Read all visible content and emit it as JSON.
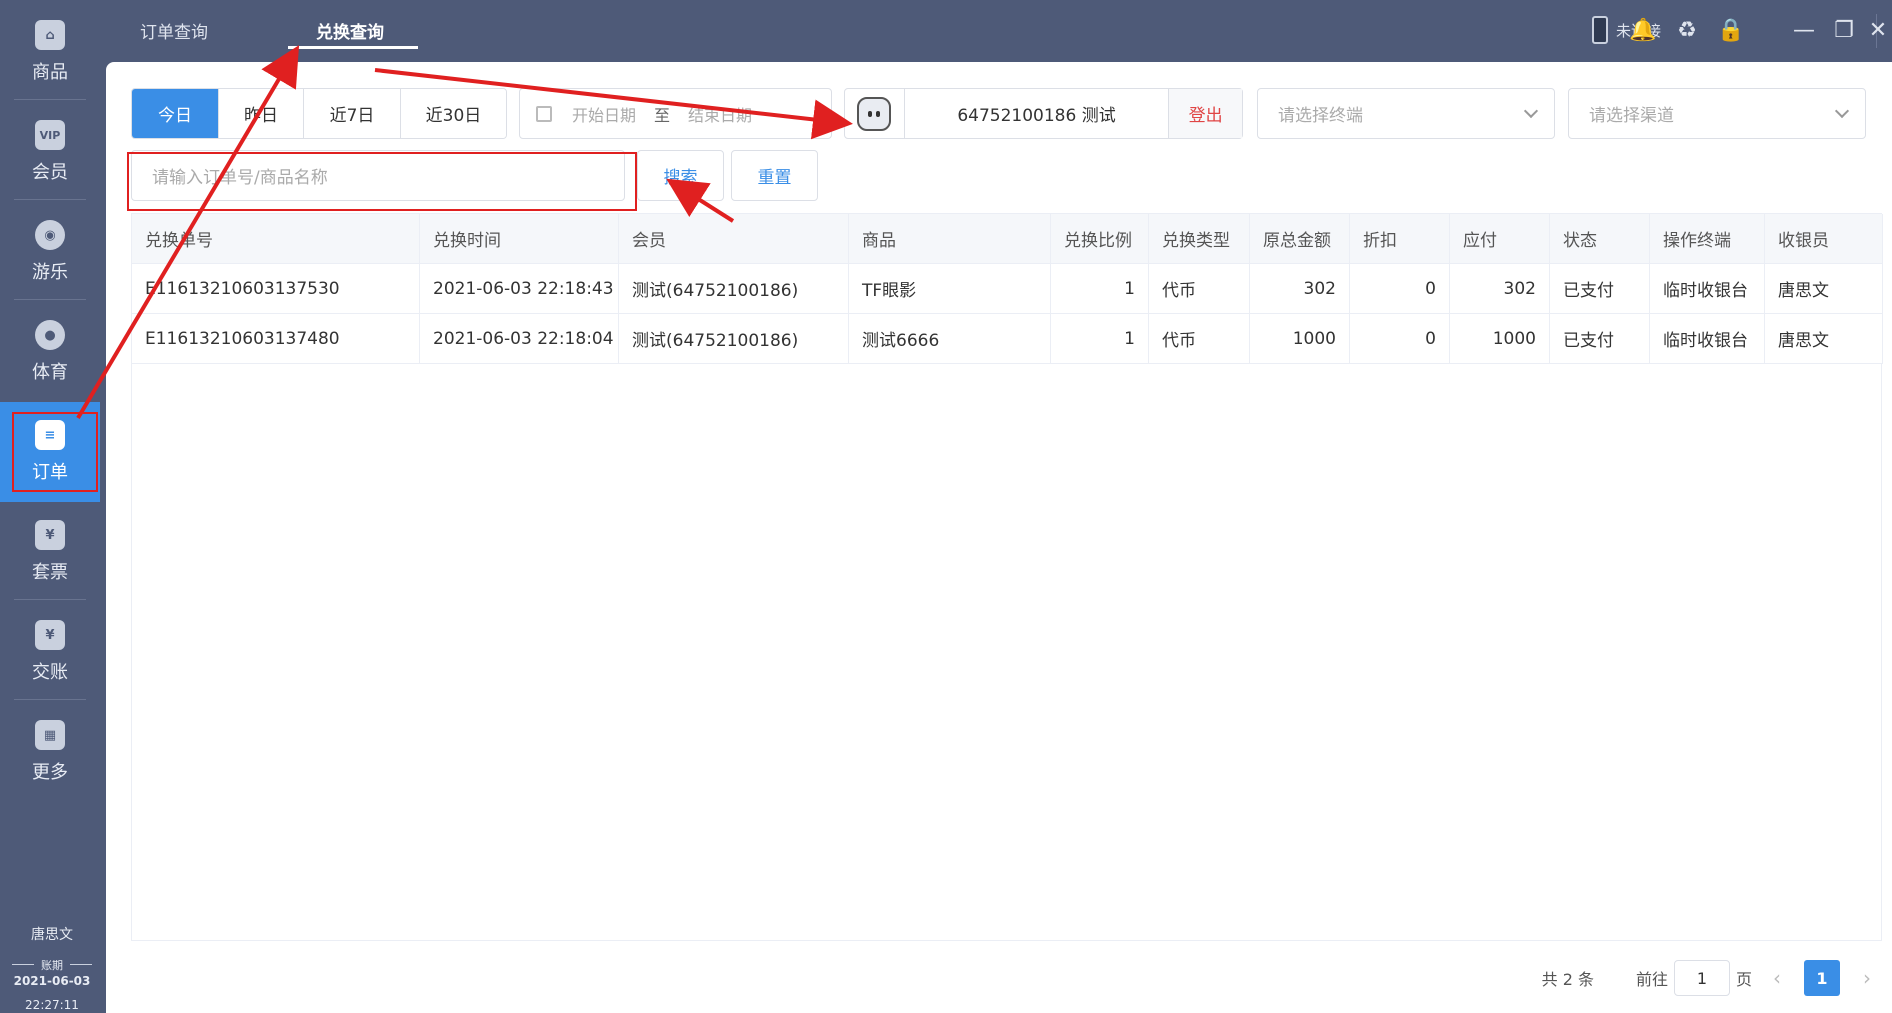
{
  "sidebar": {
    "items": [
      {
        "label": "商品",
        "icon": "bag-icon",
        "glyph": "⌂"
      },
      {
        "label": "会员",
        "icon": "vip-card-icon",
        "glyph": "VIP"
      },
      {
        "label": "游乐",
        "icon": "balloon-icon",
        "glyph": "◉"
      },
      {
        "label": "体育",
        "icon": "ball-icon",
        "glyph": "●"
      },
      {
        "label": "订单",
        "icon": "clipboard-icon",
        "glyph": "≡"
      },
      {
        "label": "套票",
        "icon": "ticket-icon",
        "glyph": "¥"
      },
      {
        "label": "交账",
        "icon": "bill-icon",
        "glyph": "¥"
      },
      {
        "label": "更多",
        "icon": "grid-icon",
        "glyph": "▦"
      }
    ],
    "user": "唐思文",
    "ledger_label": "账期",
    "ledger_date": "2021-06-03",
    "ledger_time": "22:27:11"
  },
  "tabs": [
    {
      "label": "订单查询"
    },
    {
      "label": "兑换查询"
    }
  ],
  "topbar": {
    "connection_status": "未连接",
    "icons": {
      "bell": "🔔",
      "headset": "♻",
      "lock": "🔒",
      "minimize": "—",
      "restore": "❐",
      "close": "✕"
    }
  },
  "filters": {
    "ranges": [
      "今日",
      "昨日",
      "近7日",
      "近30日"
    ],
    "start_placeholder": "开始日期",
    "range_sep": "至",
    "end_placeholder": "结束日期",
    "member": "64752100186  测试",
    "logout": "登出",
    "terminal_placeholder": "请选择终端",
    "channel_placeholder": "请选择渠道",
    "search_placeholder": "请输入订单号/商品名称",
    "search_button": "搜索",
    "reset_button": "重置"
  },
  "table": {
    "columns": [
      "兑换单号",
      "兑换时间",
      "会员",
      "商品",
      "兑换比例",
      "兑换类型",
      "原总金额",
      "折扣",
      "应付",
      "状态",
      "操作终端",
      "收银员"
    ],
    "rows": [
      [
        "E11613210603137530",
        "2021-06-03 22:18:43",
        "测试(64752100186)",
        "TF眼影",
        "1",
        "代币",
        "302",
        "0",
        "302",
        "已支付",
        "临时收银台",
        "唐思文"
      ],
      [
        "E11613210603137480",
        "2021-06-03 22:18:04",
        "测试(64752100186)",
        "测试6666",
        "1",
        "代币",
        "1000",
        "0",
        "1000",
        "已支付",
        "临时收银台",
        "唐思文"
      ]
    ]
  },
  "pager": {
    "total": "共 2 条",
    "goto": "前往",
    "page_value": "1",
    "page_unit": "页",
    "current": "1",
    "prev": "‹",
    "next": "›"
  },
  "colors": {
    "accent": "#3a8ee6",
    "sidebar": "#4e5a78",
    "annotation": "#e02020",
    "logout": "#e04545"
  }
}
